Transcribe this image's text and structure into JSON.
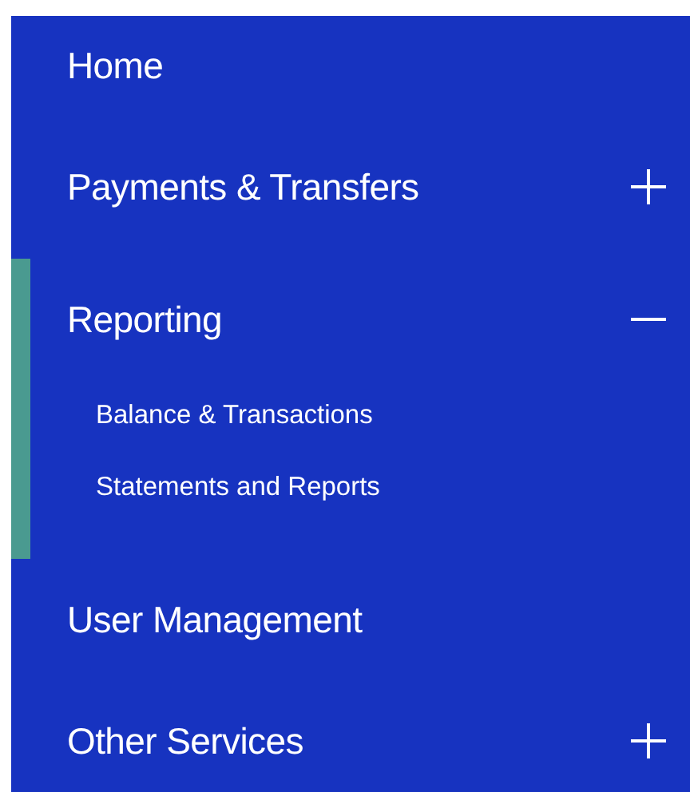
{
  "menu": [
    {
      "label": "Home",
      "kind": "link",
      "selected": false
    },
    {
      "label": "Payments & Transfers",
      "kind": "group",
      "selected": false,
      "expanded": false
    },
    {
      "label": "Reporting",
      "kind": "group",
      "selected": true,
      "expanded": true,
      "children": [
        {
          "label": "Balance & Transactions"
        },
        {
          "label": "Statements and Reports"
        }
      ]
    },
    {
      "label": "User Management",
      "kind": "link",
      "selected": false
    },
    {
      "label": "Other Services",
      "kind": "group",
      "selected": false,
      "expanded": false
    }
  ]
}
